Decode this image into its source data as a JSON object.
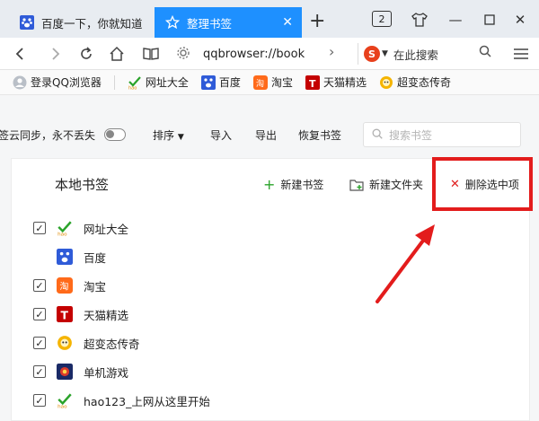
{
  "tabs": [
    {
      "title": "百度一下，你就知道",
      "icon": "baidu-paw-icon"
    },
    {
      "title": "整理书签",
      "icon": "star-icon"
    }
  ],
  "window": {
    "tab_count": "2"
  },
  "address": {
    "url": "qqbrowser://book",
    "search_placeholder": "在此搜索"
  },
  "favorites": [
    {
      "label": "登录QQ浏览器",
      "icon": "user-icon"
    },
    {
      "label": "网址大全",
      "icon": "hao123-icon"
    },
    {
      "label": "百度",
      "icon": "baidu-paw-icon"
    },
    {
      "label": "淘宝",
      "icon": "taobao-icon"
    },
    {
      "label": "天猫精选",
      "icon": "tmall-icon"
    },
    {
      "label": "超变态传奇",
      "icon": "game-face-icon"
    }
  ],
  "toolbar": {
    "sync": "签云同步，永不丢失",
    "sort": "排序",
    "import": "导入",
    "export": "导出",
    "restore": "恢复书签",
    "search_placeholder": "搜索书签"
  },
  "panel": {
    "title": "本地书签",
    "new_bookmark": "新建书签",
    "new_folder": "新建文件夹",
    "delete_selected": "删除选中项"
  },
  "bookmarks": [
    {
      "label": "网址大全",
      "checked": true,
      "icon": "hao123-icon"
    },
    {
      "label": "百度",
      "checked": false,
      "icon": "baidu-paw-icon"
    },
    {
      "label": "淘宝",
      "checked": true,
      "icon": "taobao-icon"
    },
    {
      "label": "天猫精选",
      "checked": true,
      "icon": "tmall-icon"
    },
    {
      "label": "超变态传奇",
      "checked": true,
      "icon": "game-face-icon"
    },
    {
      "label": "单机游戏",
      "checked": true,
      "icon": "game-icon"
    },
    {
      "label": "hao123_上网从这里开始",
      "checked": true,
      "icon": "hao123-icon"
    }
  ],
  "colors": {
    "accent": "#1e90ff",
    "highlight": "#e31c1c",
    "green": "#2aa32a"
  }
}
